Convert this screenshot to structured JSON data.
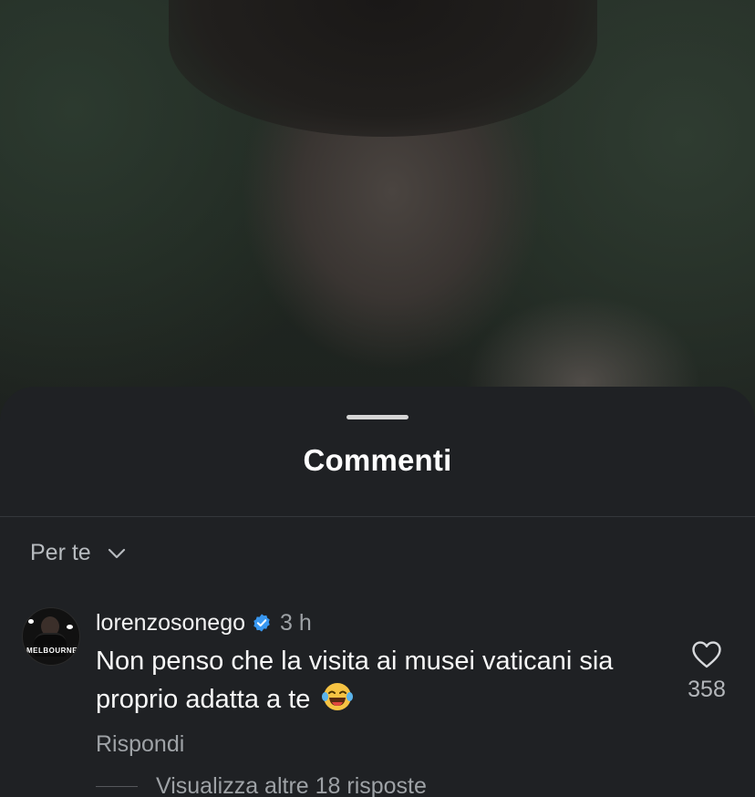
{
  "sheet": {
    "title": "Commenti",
    "sort_label": "Per te"
  },
  "comment": {
    "username": "lorenzosonego",
    "verified": true,
    "time": "3 h",
    "text": "Non penso che la visita ai musei vaticani sia proprio adatta a te",
    "emoji": "😂",
    "likes": "358",
    "reply_label": "Rispondi",
    "view_replies_label": "Visualizza altre 18 risposte",
    "avatar_text": "MELBOURNE"
  },
  "icons": {
    "sort": "chevron-down-icon",
    "verified": "verified-badge-icon",
    "like": "heart-icon",
    "emoji": "face-with-tears-of-joy-icon"
  },
  "colors": {
    "sheet_bg": "#1f2124",
    "verified_blue": "#3897f0",
    "muted_text": "#9ea2a6"
  }
}
